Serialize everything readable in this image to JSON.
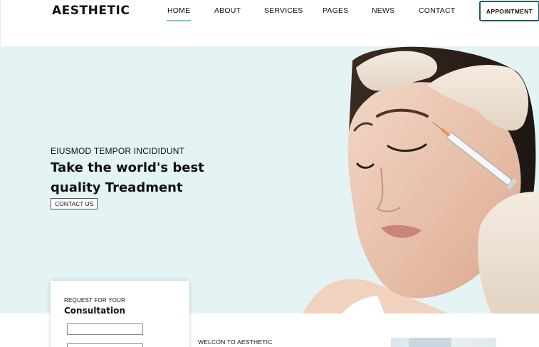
{
  "brand": {
    "logo_text": "AESTHETIC"
  },
  "nav": {
    "items": [
      {
        "label": "HOME",
        "active": true
      },
      {
        "label": "ABOUT"
      },
      {
        "label": "SERVICES"
      },
      {
        "label": "PAGES"
      },
      {
        "label": "NEWS"
      },
      {
        "label": "CONTACT"
      }
    ],
    "cta_label": "APPOINTMENT"
  },
  "hero": {
    "kicker": "EIUSMOD TEMPOR INCIDIDUNT",
    "title_line1": "Take the world's best",
    "title_line2": "quality Treadment",
    "cta_label": "CONTACT US",
    "background_color": "#e4f3f4"
  },
  "consultation": {
    "kicker": "REQUEST FOR YOUR",
    "title": "Consultation"
  },
  "welcome": {
    "label": "WELCON TO AESTHETIC"
  },
  "colors": {
    "accent": "#7fc7c9",
    "button_border": "#1f5d66"
  }
}
